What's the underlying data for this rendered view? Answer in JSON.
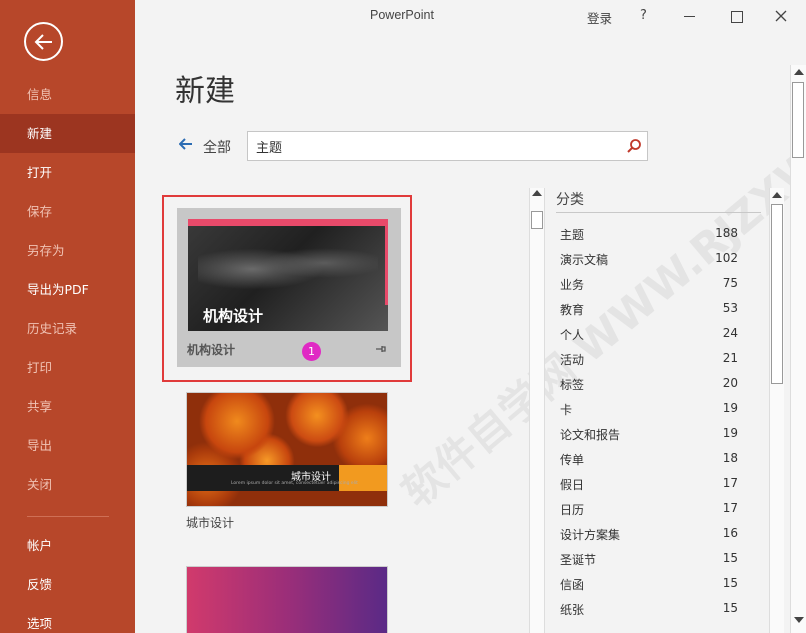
{
  "window": {
    "title": "PowerPoint",
    "login": "登录",
    "help": "?"
  },
  "sidebar": {
    "items": [
      {
        "label": "信息"
      },
      {
        "label": "新建"
      },
      {
        "label": "打开"
      },
      {
        "label": "保存"
      },
      {
        "label": "另存为"
      },
      {
        "label": "导出为PDF"
      },
      {
        "label": "历史记录"
      },
      {
        "label": "打印"
      },
      {
        "label": "共享"
      },
      {
        "label": "导出"
      },
      {
        "label": "关闭"
      },
      {
        "label": "帐户"
      },
      {
        "label": "反馈"
      },
      {
        "label": "选项"
      }
    ],
    "active_index": 1
  },
  "main": {
    "title": "新建",
    "all_label": "全部",
    "search_value": "主题"
  },
  "templates": [
    {
      "name": "机构设计",
      "badge": "1"
    },
    {
      "name": "城市设计",
      "subtitle": "Lorem ipsum dolor sit amet, consectetuer adipiscing elit"
    },
    {
      "name": ""
    }
  ],
  "categories": {
    "header": "分类",
    "items": [
      {
        "name": "主题",
        "count": "188"
      },
      {
        "name": "演示文稿",
        "count": "102"
      },
      {
        "name": "业务",
        "count": "75"
      },
      {
        "name": "教育",
        "count": "53"
      },
      {
        "name": "个人",
        "count": "24"
      },
      {
        "name": "活动",
        "count": "21"
      },
      {
        "name": "标签",
        "count": "20"
      },
      {
        "name": "卡",
        "count": "19"
      },
      {
        "name": "论文和报告",
        "count": "19"
      },
      {
        "name": "传单",
        "count": "18"
      },
      {
        "name": "假日",
        "count": "17"
      },
      {
        "name": "日历",
        "count": "17"
      },
      {
        "name": "设计方案集",
        "count": "16"
      },
      {
        "name": "圣诞节",
        "count": "15"
      },
      {
        "name": "信函",
        "count": "15"
      },
      {
        "name": "纸张",
        "count": "15"
      }
    ]
  },
  "watermark": "软件自学网 WWW.RJZXW.COM",
  "colors": {
    "sidebar": "#b7472a",
    "sidebar_active": "#9c3520",
    "selection_border": "#e03a3a",
    "badge": "#e029c4"
  }
}
